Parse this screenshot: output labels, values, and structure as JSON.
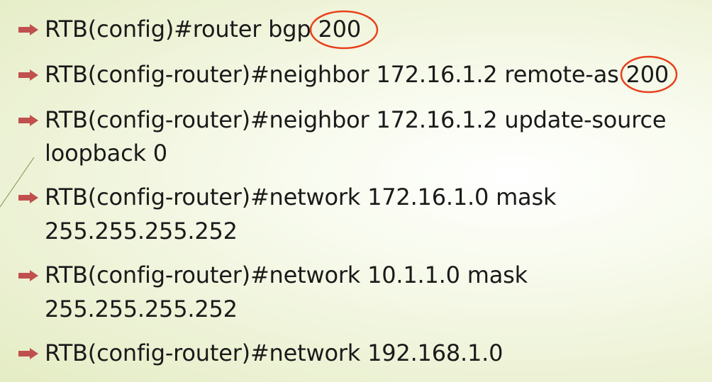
{
  "slide": {
    "accent_color": "#c0504d",
    "circle_color": "#e8401c",
    "bullet_icon": "right-arrow-bullet-icon",
    "bullets": [
      {
        "prefix": "RTB(config)#router bgp ",
        "highlight": "200",
        "suffix": ""
      },
      {
        "prefix": "RTB(config-router)#neighbor 172.16.1.2 remote-as ",
        "highlight": "200",
        "suffix": ""
      },
      {
        "line1": "RTB(config-router)#neighbor 172.16.1.2 update-source",
        "line2": "loopback 0"
      },
      {
        "line1": "RTB(config-router)#network 172.16.1.0 mask",
        "line2": "255.255.255.252"
      },
      {
        "line1": "RTB(config-router)#network 10.1.1.0 mask",
        "line2": "255.255.255.252"
      },
      {
        "line1": "RTB(config-router)#network 192.168.1.0"
      }
    ]
  }
}
